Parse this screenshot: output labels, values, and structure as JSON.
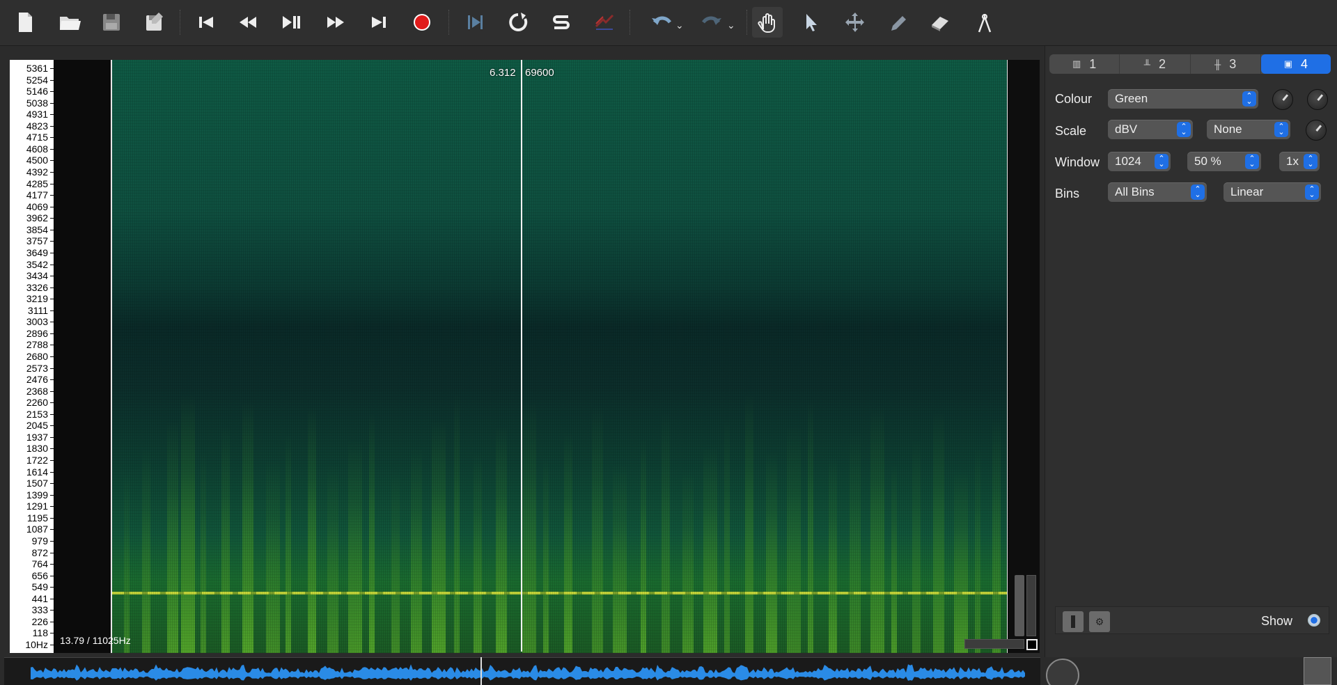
{
  "toolbar": {
    "buttons": [
      {
        "name": "new-file-icon",
        "glyph": "new"
      },
      {
        "name": "open-folder-icon",
        "glyph": "open"
      },
      {
        "name": "save-icon",
        "glyph": "save"
      },
      {
        "name": "save-as-icon",
        "glyph": "saveas"
      },
      {
        "name": "skip-to-start-icon",
        "glyph": "start"
      },
      {
        "name": "rewind-icon",
        "glyph": "rew"
      },
      {
        "name": "play-pause-icon",
        "glyph": "play"
      },
      {
        "name": "fast-forward-icon",
        "glyph": "ff"
      },
      {
        "name": "skip-to-end-icon",
        "glyph": "end"
      },
      {
        "name": "record-icon",
        "glyph": "rec"
      },
      {
        "name": "play-selection-icon",
        "glyph": "playsel"
      },
      {
        "name": "loop-icon",
        "glyph": "loop"
      },
      {
        "name": "solo-icon",
        "glyph": "solo"
      },
      {
        "name": "align-icon",
        "glyph": "align"
      },
      {
        "name": "undo-icon",
        "glyph": "undo"
      },
      {
        "name": "redo-icon",
        "glyph": "redo"
      },
      {
        "name": "navigate-hand-icon",
        "glyph": "hand"
      },
      {
        "name": "select-arrow-icon",
        "glyph": "arrow"
      },
      {
        "name": "move-icon",
        "glyph": "move"
      },
      {
        "name": "draw-pencil-icon",
        "glyph": "pencil"
      },
      {
        "name": "erase-icon",
        "glyph": "eraser"
      },
      {
        "name": "measure-icon",
        "glyph": "measure"
      }
    ]
  },
  "frequency_scale": {
    "labels": [
      "5361",
      "5254",
      "5146",
      "5038",
      "4931",
      "4823",
      "4715",
      "4608",
      "4500",
      "4392",
      "4285",
      "4177",
      "4069",
      "3962",
      "3854",
      "3757",
      "3649",
      "3542",
      "3434",
      "3326",
      "3219",
      "3111",
      "3003",
      "2896",
      "2788",
      "2680",
      "2573",
      "2476",
      "2368",
      "2260",
      "2153",
      "2045",
      "1937",
      "1830",
      "1722",
      "1614",
      "1507",
      "1399",
      "1291",
      "1195",
      "1087",
      "979",
      "872",
      "764",
      "656",
      "549",
      "441",
      "333",
      "226",
      "118",
      "10Hz"
    ]
  },
  "spectrogram": {
    "colour_map": "#1a6b2f",
    "cursor_time": "6.312",
    "cursor_frame": "69600",
    "position_readout": "13.79 / 11025Hz"
  },
  "panel": {
    "tabs": [
      {
        "label": "1",
        "icon": "pane-icon"
      },
      {
        "label": "2",
        "icon": "spectrum-icon"
      },
      {
        "label": "3",
        "icon": "waveform-icon"
      },
      {
        "label": "4",
        "icon": "spectrogram-icon"
      }
    ],
    "colour_label": "Colour",
    "colour_value": "Green",
    "scale_label": "Scale",
    "scale_value": "dBV",
    "scale_normalize": "None",
    "window_label": "Window",
    "window_size": "1024",
    "window_overlap": "50 %",
    "window_oversample": "1x",
    "bins_label": "Bins",
    "bins_value": "All Bins",
    "bins_scale": "Linear",
    "show_label": "Show"
  },
  "colors": {
    "accent": "#1f6fe5",
    "waveform": "#2a8be6",
    "record": "#e01b1b"
  }
}
